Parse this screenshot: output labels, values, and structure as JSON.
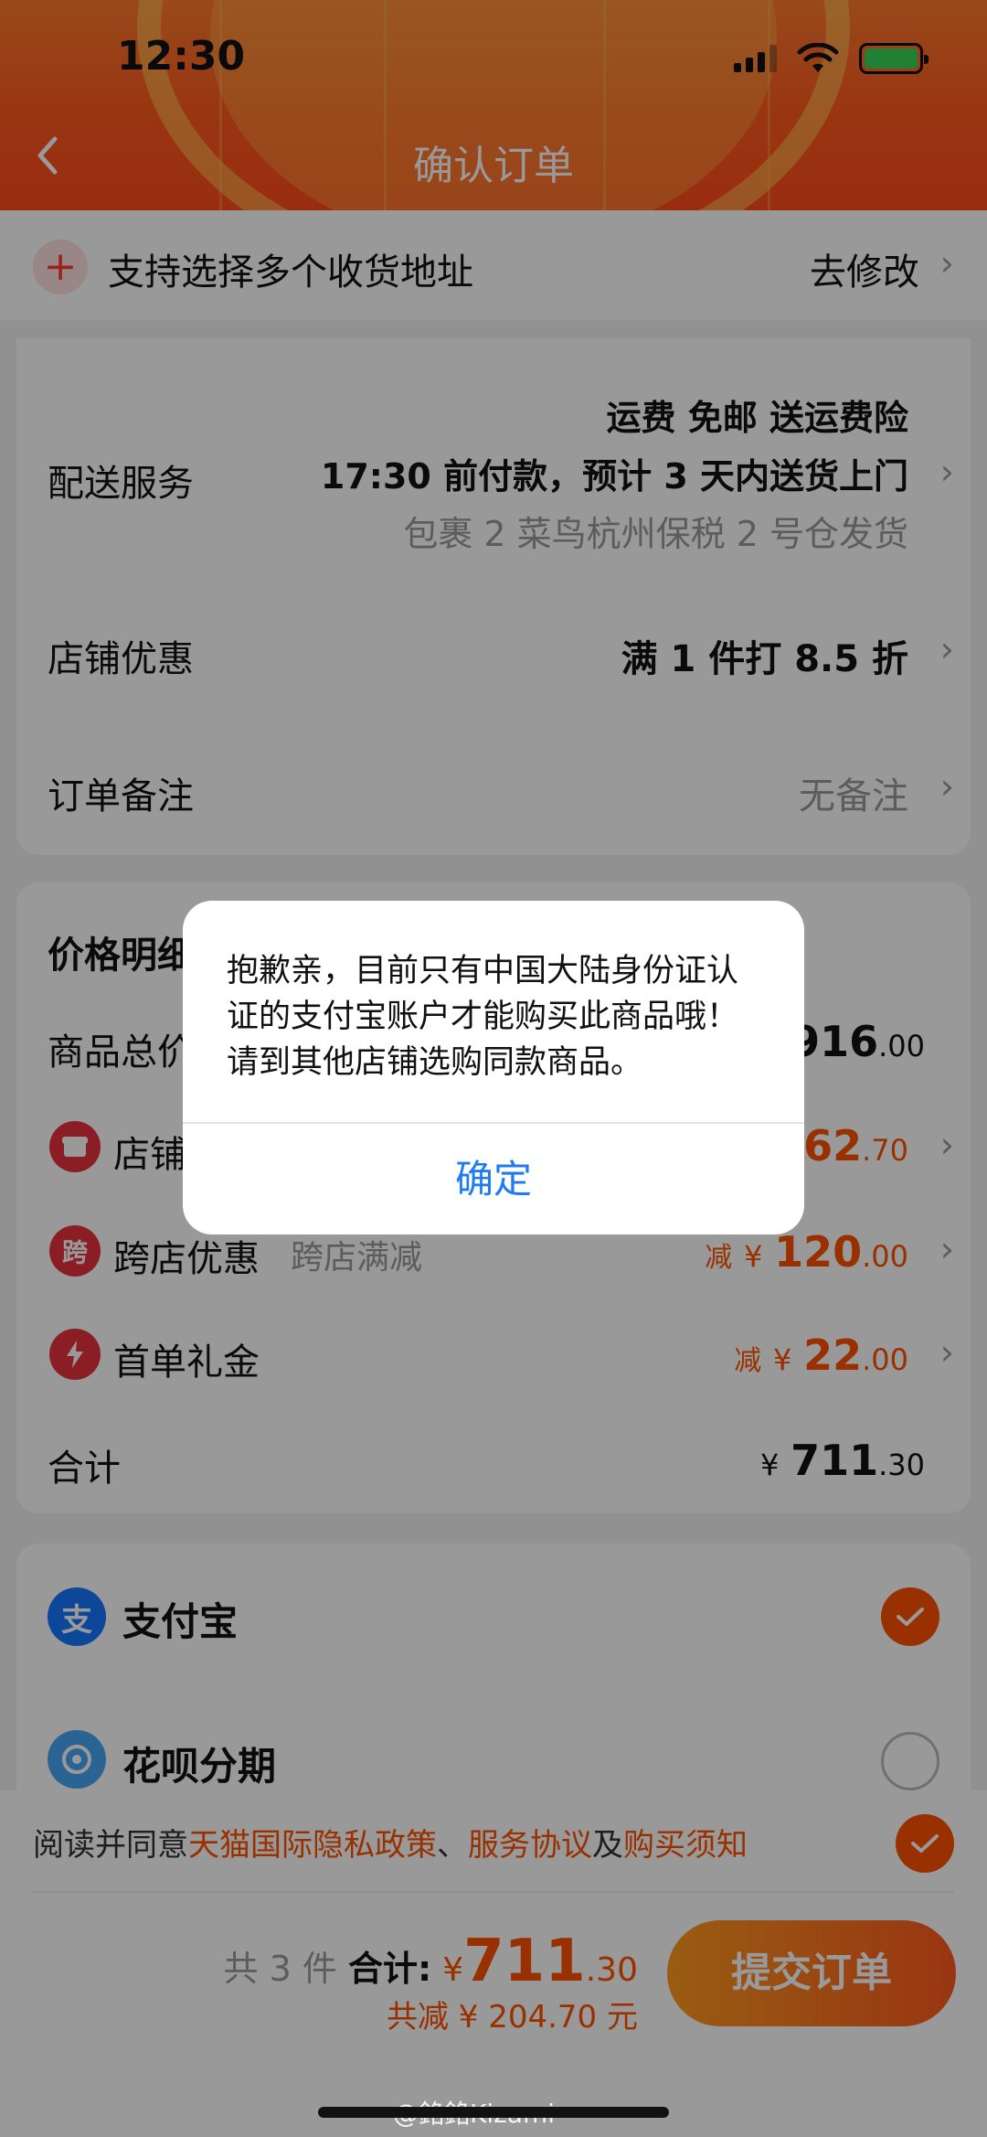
{
  "status_bar": {
    "time": "12:30"
  },
  "header": {
    "title": "确认订单"
  },
  "address_bar": {
    "text": "支持选择多个收货地址",
    "action": "去修改"
  },
  "delivery": {
    "label": "配送服务",
    "line1": "运费 免邮 送运费险",
    "line2": "17:30 前付款，预计 3 天内送货上门",
    "line3": "包裹 2 菜鸟杭州保税 2 号仓发货"
  },
  "store_promo": {
    "label": "店铺优惠",
    "value": "满 1 件打 8.5 折"
  },
  "order_note": {
    "label": "订单备注",
    "value": "无备注"
  },
  "price_detail": {
    "title": "价格明细",
    "goods_total": {
      "label": "商品总价",
      "currency": "¥",
      "int": "916",
      "dec": ".00"
    },
    "store_discount": {
      "label": "店铺优惠",
      "currency": "¥",
      "int": "62",
      "dec": ".70"
    },
    "cross_store": {
      "label": "跨店优惠",
      "tag": "跨店满减",
      "prefix": "减",
      "currency": "¥",
      "int": "120",
      "dec": ".00",
      "icon_text": "跨"
    },
    "first_order": {
      "label": "首单礼金",
      "prefix": "减",
      "currency": "¥",
      "int": "22",
      "dec": ".00"
    },
    "total": {
      "label": "合计",
      "currency": "¥",
      "int": "711",
      "dec": ".30"
    }
  },
  "payment": {
    "alipay": {
      "label": "支付宝",
      "icon_text": "支",
      "selected": true
    },
    "huabei": {
      "label": "花呗分期",
      "selected": false
    }
  },
  "agreement": {
    "prefix": "阅读并同意",
    "policy": "天猫国际隐私政策",
    "sep1": "、",
    "service": "服务协议",
    "sep2": "及",
    "notice": "购买须知"
  },
  "footer": {
    "count": "共 3 件",
    "total_label": "合计:",
    "currency": "¥",
    "int": "711",
    "dec": ".30",
    "saved": "共减 ¥ 204.70 元",
    "submit": "提交订单"
  },
  "dialog": {
    "message": "抱歉亲，目前只有中国大陆身份证认证的支付宝账户才能购买此商品哦！请到其他店铺选购同款商品。",
    "confirm": "确定"
  },
  "watermark": "@銘銘Kizami",
  "colors": {
    "brand": "#ff5000",
    "link": "#1e7bf0",
    "alipay": "#1677ff"
  }
}
